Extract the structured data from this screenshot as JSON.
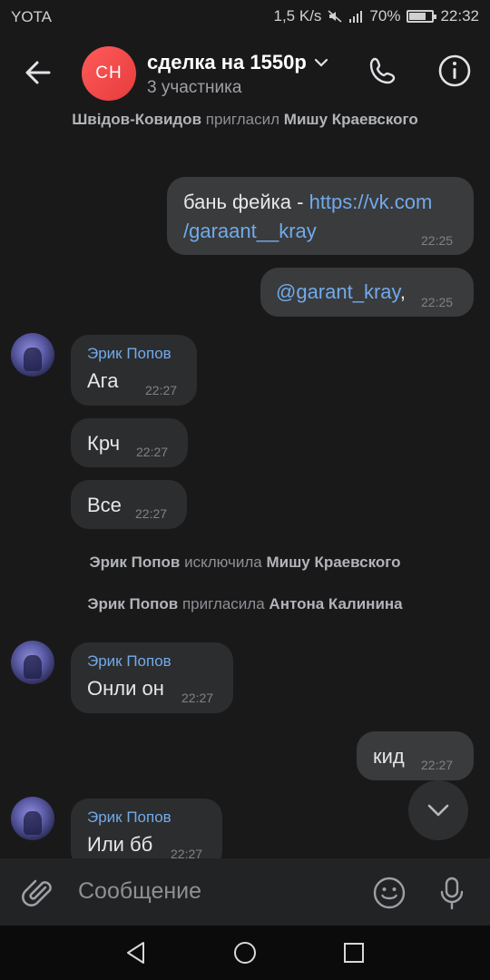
{
  "status_bar": {
    "carrier": "YOTA",
    "speed": "1,5 K/s",
    "battery": "70%",
    "time": "22:32"
  },
  "header": {
    "avatar_initials": "СН",
    "title": "сделка на 1550р",
    "subtitle": "3 участника"
  },
  "system_messages": [
    {
      "actor": "Швідов-Ковидов",
      "action": "пригласил",
      "target": "Мишу Краевского"
    },
    {
      "actor": "Эрик Попов",
      "action": "исключила",
      "target": "Мишу Краевского"
    },
    {
      "actor": "Эрик Попов",
      "action": "пригласила",
      "target": "Антона Калинина"
    }
  ],
  "messages": [
    {
      "direction": "out",
      "text_prefix": "бань фейка - ",
      "link_line1": "https://vk.com",
      "link_line2": "/garaant__kray",
      "time": "22:25"
    },
    {
      "direction": "out",
      "link": "@garant_kray",
      "text_suffix": ",",
      "time": "22:25"
    },
    {
      "direction": "in",
      "author": "Эрик Попов",
      "text": "Ага",
      "time": "22:27"
    },
    {
      "direction": "in",
      "text": "Крч",
      "time": "22:27"
    },
    {
      "direction": "in",
      "text": "Все",
      "time": "22:27"
    },
    {
      "direction": "in",
      "author": "Эрик Попов",
      "text": "Онли он",
      "time": "22:27"
    },
    {
      "direction": "out",
      "text": "кид",
      "time": "22:27"
    },
    {
      "direction": "in",
      "author": "Эрик Попов",
      "text": "Или бб",
      "time": "22:27"
    }
  ],
  "composer": {
    "placeholder": "Сообщение"
  },
  "icons": {
    "back": "arrow-left-icon",
    "phone": "phone-icon",
    "info": "info-icon",
    "attach": "paperclip-icon",
    "emoji": "smile-icon",
    "mic": "microphone-icon",
    "scroll_down": "chevron-down-icon"
  },
  "colors": {
    "background": "#19191a",
    "avatar_accent": "#e63c3c",
    "link": "#71aaeb",
    "bubble_in": "#2c2d2e",
    "bubble_out": "#3a3b3c"
  }
}
